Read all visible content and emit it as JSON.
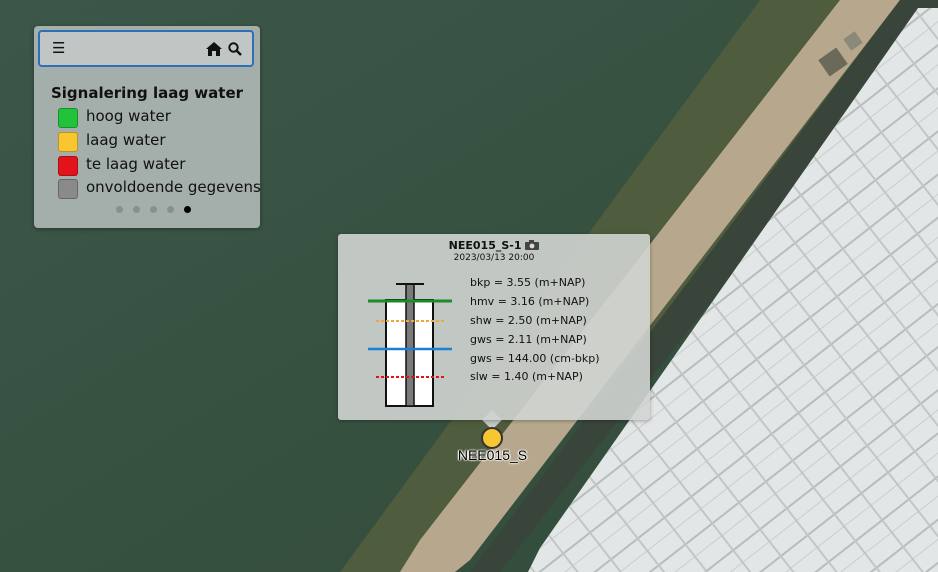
{
  "toolbar": {
    "menu_icon": "menu-icon",
    "home_icon": "home-icon",
    "search_icon": "search-icon"
  },
  "legend": {
    "title": "Signalering laag water",
    "items": [
      {
        "label": "hoog water",
        "color": "#22c23a"
      },
      {
        "label": "laag water",
        "color": "#f7c630"
      },
      {
        "label": "te laag water",
        "color": "#e3131b"
      },
      {
        "label": "onvoldoende gegevens",
        "color": "#8a8a8a"
      }
    ],
    "pager": {
      "pages": 5,
      "active": 5
    }
  },
  "popup": {
    "title": "NEE015_S-1",
    "camera_icon": "camera-icon",
    "date": "2023/03/13 20:00",
    "rows": [
      "bkp = 3.55 (m+NAP)",
      "hmv = 3.16 (m+NAP)",
      "shw = 2.50 (m+NAP)",
      "gws = 2.11 (m+NAP)",
      "gws = 144.00 (cm-bkp)",
      "slw = 1.40 (m+NAP)"
    ],
    "diagram_colors": {
      "hmv": "#1f8a2a",
      "shw": "#f0a63a",
      "gws": "#1e7fd6",
      "slw": "#e3131b"
    }
  },
  "marker": {
    "label": "NEE015_S",
    "color": "#f7c630"
  }
}
